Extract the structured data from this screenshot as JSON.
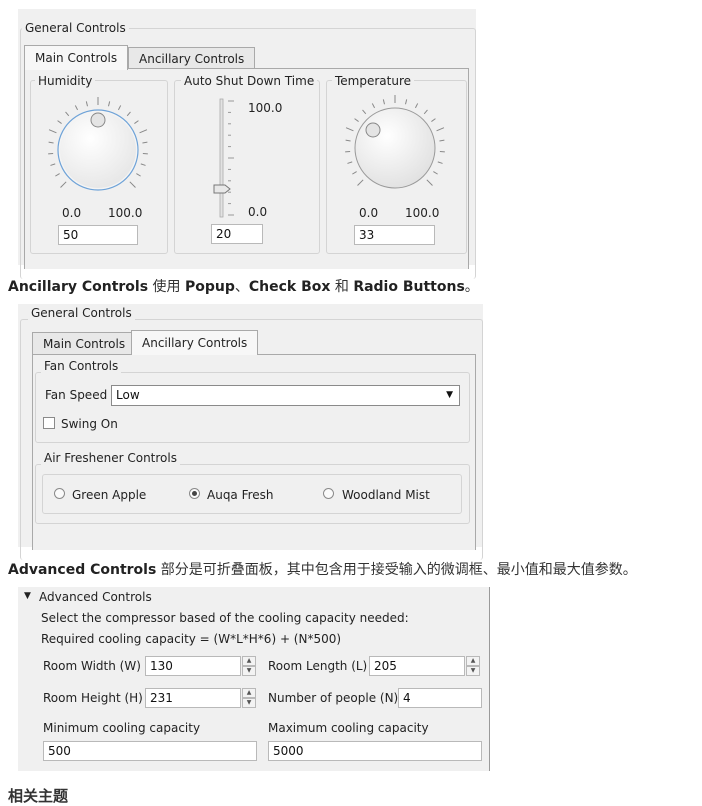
{
  "main_screenshot": {
    "group_title": "General Controls",
    "tabs": [
      "Main Controls",
      "Ancillary Controls"
    ],
    "humidity": {
      "title": "Humidity",
      "min": "0.0",
      "max": "100.0",
      "value": "50",
      "level": 0.5
    },
    "shutdown": {
      "title": "Auto Shut Down Time",
      "max": "100.0",
      "min": "0.0",
      "value": "20",
      "level": 0.2
    },
    "temperature": {
      "title": "Temperature",
      "min": "0.0",
      "max": "100.0",
      "value": "33",
      "level": 0.33
    }
  },
  "caption1": {
    "b1": "Ancillary Controls",
    "t1": " 使用 ",
    "b2": "Popup",
    "t2": "、",
    "b3": "Check Box",
    "t3": " 和 ",
    "b4": "Radio Buttons",
    "t4": "。"
  },
  "ancillary_screenshot": {
    "group_title": "General Controls",
    "tabs": [
      "Main Controls",
      "Ancillary Controls"
    ],
    "fan_group": "Fan Controls",
    "fan_speed_label": "Fan Speed",
    "fan_speed_value": "Low",
    "swing_label": "Swing On",
    "freshener_group": "Air Freshener Controls",
    "radios": [
      "Green Apple",
      "Auqa Fresh",
      "Woodland Mist"
    ],
    "selected_radio": "Auqa Fresh"
  },
  "caption2": {
    "b1": "Advanced Controls",
    "t1": " 部分是可折叠面板，其中包含用于接受输入的微调框、最小值和最大值参数。"
  },
  "advanced_screenshot": {
    "header": "Advanced Controls",
    "line1": "Select the compressor based of the cooling capacity needed:",
    "line2": "Required cooling capacity = (W*L*H*6) + (N*500)",
    "room_width_label": "Room Width (W)",
    "room_width": "130",
    "room_length_label": "Room Length (L)",
    "room_length": "205",
    "room_height_label": "Room Height (H)",
    "room_height": "231",
    "people_label": "Number of people (N)",
    "people": "4",
    "min_label": "Minimum cooling capacity",
    "min_value": "500",
    "max_label": "Maximum cooling capacity",
    "max_value": "5000"
  },
  "cutoff_heading": "相关主题"
}
